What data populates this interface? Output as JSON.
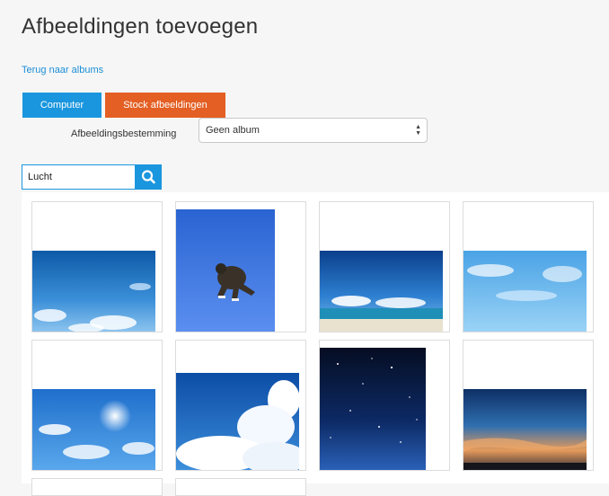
{
  "header": {
    "title": "Afbeeldingen toevoegen",
    "back_link": "Terug naar albums"
  },
  "source_tabs": [
    {
      "label": "Computer",
      "color": "#1a96de"
    },
    {
      "label": "Stock afbeeldingen",
      "color": "#e35f23"
    }
  ],
  "destination": {
    "label": "Afbeeldingsbestemming",
    "selected": "Geen album"
  },
  "search": {
    "value": "Lucht",
    "icon": "search-icon"
  },
  "images": [
    {
      "name": "sky-clouds-image"
    },
    {
      "name": "gorilla-jumping-image"
    },
    {
      "name": "sky-beach-image"
    },
    {
      "name": "light-blue-sky-image"
    },
    {
      "name": "sky-sun-image"
    },
    {
      "name": "cumulus-clouds-image"
    },
    {
      "name": "starry-night-image"
    },
    {
      "name": "sunset-sky-image"
    }
  ]
}
